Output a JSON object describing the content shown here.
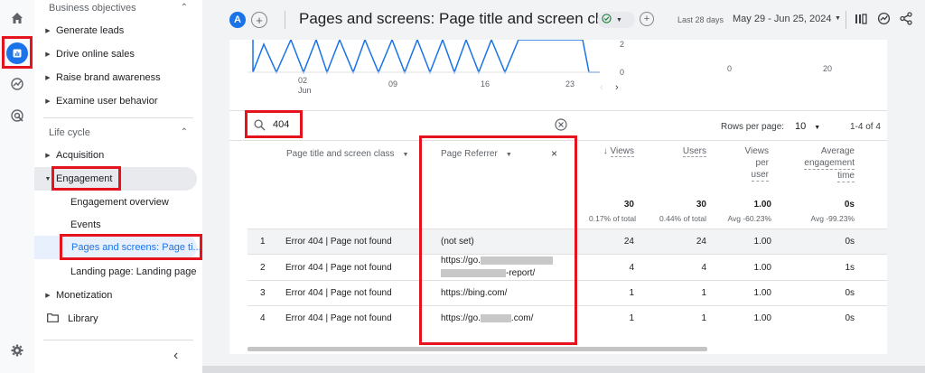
{
  "nav": {
    "group_business": "Business objectives",
    "business_items": [
      "Generate leads",
      "Drive online sales",
      "Raise brand awareness",
      "Examine user behavior"
    ],
    "group_lifecycle": "Life cycle",
    "acquisition": "Acquisition",
    "engagement": "Engagement",
    "engagement_sub": [
      "Engagement overview",
      "Events",
      "Pages and screens: Page ti...",
      "Landing page: Landing page"
    ],
    "monetization": "Monetization",
    "library": "Library"
  },
  "header": {
    "avatar_letter": "A",
    "title": "Pages and screens: Page title and screen class",
    "date_label": "Last 28 days",
    "date_range": "May 29 - Jun 25, 2024"
  },
  "chart": {
    "x_ticks": [
      "02",
      "09",
      "16",
      "23"
    ],
    "x_month": "Jun",
    "y_ticks": [
      "2",
      "0"
    ],
    "scatter_x_ticks": [
      "0",
      "20"
    ]
  },
  "search": {
    "value": "404"
  },
  "pagination": {
    "rows_label": "Rows per page:",
    "rows_value": "10",
    "range": "1-4 of 4"
  },
  "table": {
    "col_page": "Page title and screen class",
    "col_referrer": "Page Referrer",
    "col_views": "Views",
    "col_users": "Users",
    "col_vpu": [
      "Views",
      "per",
      "user"
    ],
    "col_aet": [
      "Average",
      "engagement",
      "time"
    ],
    "totals": {
      "views": "30",
      "views_sub": "0.17% of total",
      "users": "30",
      "users_sub": "0.44% of total",
      "vpu": "1.00",
      "vpu_sub": "Avg -60.23%",
      "aet": "0s",
      "aet_sub": "Avg -99.23%"
    },
    "rows": [
      {
        "n": "1",
        "page": "Error 404 | Page not found",
        "ref": "(not set)",
        "views": "24",
        "users": "24",
        "vpu": "1.00",
        "aet": "0s"
      },
      {
        "n": "2",
        "page": "Error 404 | Page not found",
        "ref_a": "https://go.",
        "ref_b": "-report/",
        "views": "4",
        "users": "4",
        "vpu": "1.00",
        "aet": "1s"
      },
      {
        "n": "3",
        "page": "Error 404 | Page not found",
        "ref": "https://bing.com/",
        "views": "1",
        "users": "1",
        "vpu": "1.00",
        "aet": "0s"
      },
      {
        "n": "4",
        "page": "Error 404 | Page not found",
        "ref_a": "https://go.",
        "ref_b": ".com/",
        "views": "1",
        "users": "1",
        "vpu": "1.00",
        "aet": "0s"
      }
    ]
  },
  "colors": {
    "accent": "#1a73e8",
    "highlight": "#e5131d",
    "line": "#1a73e8"
  }
}
